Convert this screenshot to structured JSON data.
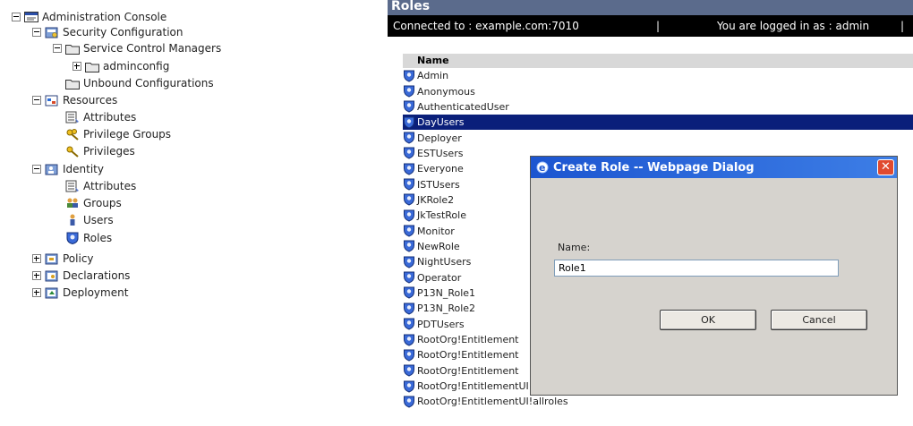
{
  "tree": {
    "items": [
      {
        "label": "Administration Console",
        "toggle": "minus",
        "icon": "console-icon"
      },
      {
        "label": "Security Configuration",
        "toggle": "minus",
        "icon": "security-config-icon"
      },
      {
        "label": "Service Control Managers",
        "toggle": "minus",
        "icon": "folder-icon"
      },
      {
        "label": "adminconfig",
        "toggle": "plus",
        "icon": "folder-icon"
      },
      {
        "label": "Unbound Configurations",
        "toggle": "none",
        "icon": "folder-icon"
      },
      {
        "label": "Resources",
        "toggle": "minus",
        "icon": "resources-icon"
      },
      {
        "label": "Attributes",
        "toggle": "none",
        "icon": "attributes-icon"
      },
      {
        "label": "Privilege Groups",
        "toggle": "none",
        "icon": "privilege-groups-icon"
      },
      {
        "label": "Privileges",
        "toggle": "none",
        "icon": "privileges-icon"
      },
      {
        "label": "Identity",
        "toggle": "minus",
        "icon": "identity-icon"
      },
      {
        "label": "Attributes",
        "toggle": "none",
        "icon": "attributes-icon"
      },
      {
        "label": "Groups",
        "toggle": "none",
        "icon": "groups-icon"
      },
      {
        "label": "Users",
        "toggle": "none",
        "icon": "user-icon"
      },
      {
        "label": "Roles",
        "toggle": "none",
        "icon": "roles-icon"
      },
      {
        "label": "Policy",
        "toggle": "plus",
        "icon": "policy-icon"
      },
      {
        "label": "Declarations",
        "toggle": "plus",
        "icon": "declarations-icon"
      },
      {
        "label": "Deployment",
        "toggle": "plus",
        "icon": "deployment-icon"
      }
    ]
  },
  "header": {
    "title": "Roles",
    "connected": "Connected to :  example.com:7010",
    "separator": "|",
    "logged_in": "You are logged in as :  admin",
    "separator2": "|"
  },
  "table": {
    "column_name": "Name",
    "rows": [
      "Admin",
      "Anonymous",
      "AuthenticatedUser",
      "DayUsers",
      "Deployer",
      "ESTUsers",
      "Everyone",
      "ISTUsers",
      "JKRole2",
      "JkTestRole",
      "Monitor",
      "NewRole",
      "NightUsers",
      "Operator",
      "P13N_Role1",
      "P13N_Role2",
      "PDTUsers",
      "RootOrg!Entitlement",
      "RootOrg!Entitlement",
      "RootOrg!Entitlement",
      "RootOrg!EntitlementUI!RootOrg#OrgAdmin",
      "RootOrg!EntitlementUI!allroles"
    ],
    "selected_row": "DayUsers"
  },
  "dialog": {
    "title": "Create Role -- Webpage Dialog",
    "close_label": "✕",
    "name_label": "Name:",
    "name_value": "Role1",
    "ok_label": "OK",
    "cancel_label": "Cancel"
  },
  "colors": {
    "selection": "#0a1f7a",
    "title_bar": "#1c55d0",
    "connection_bar": "#000000"
  }
}
